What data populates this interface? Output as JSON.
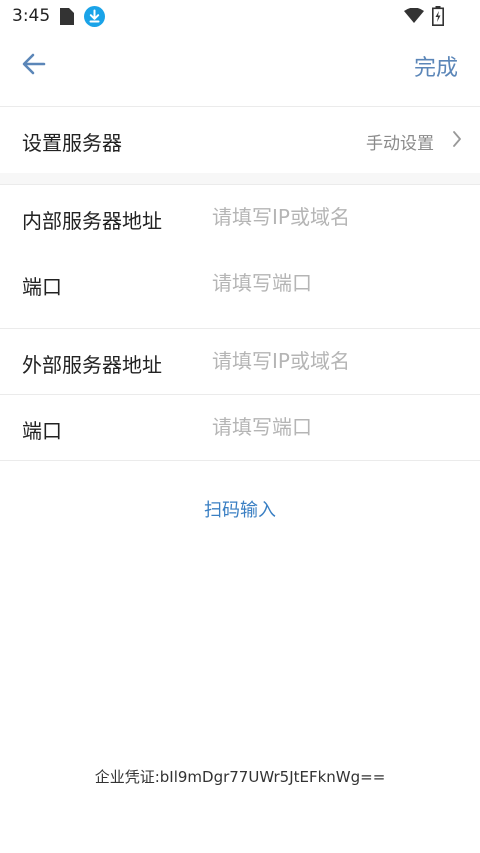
{
  "status_bar": {
    "time": "3:45",
    "icons": [
      "sim-card-icon",
      "download-icon",
      "wifi-icon",
      "battery-charging-icon"
    ],
    "download_icon_color": "#1aa3e8"
  },
  "toolbar": {
    "back_icon": "arrow-left-icon",
    "done_label": "完成",
    "accent_color": "#5b86b8"
  },
  "server_setting": {
    "label": "设置服务器",
    "value": "手动设置",
    "chevron_icon": "chevron-right-icon"
  },
  "internal": {
    "address_label": "内部服务器地址",
    "address_placeholder": "请填写IP或域名",
    "address_value": "",
    "port_label": "端口",
    "port_placeholder": "请填写端口",
    "port_value": ""
  },
  "external": {
    "address_label": "外部服务器地址",
    "address_placeholder": "请填写IP或域名",
    "address_value": "",
    "port_label": "端口",
    "port_placeholder": "请填写端口",
    "port_value": ""
  },
  "scan": {
    "label": "扫码输入",
    "color": "#3a7fc3"
  },
  "footer": {
    "credential": "企业凭证:bIl9mDgr77UWr5JtEFknWg=="
  }
}
